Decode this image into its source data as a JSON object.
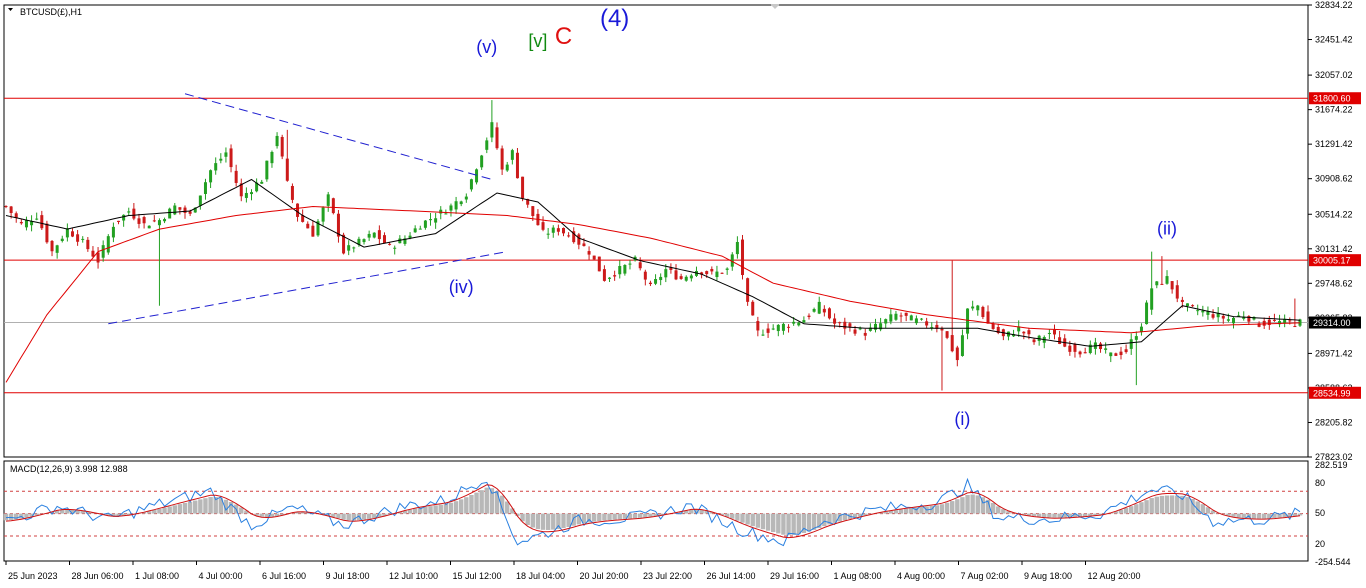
{
  "window": {
    "symbol_label": "BTCUSD(£),H1"
  },
  "colors": {
    "background": "#ffffff",
    "frame": "#000000",
    "up_candle": "#22a022",
    "down_candle": "#cc1a1a",
    "ma_fast": "#000000",
    "ma_slow": "#e00000",
    "trendline": "#2020d0",
    "hline": "#e00000",
    "price_line": "#b0b0b0",
    "wave_blue": "#1a1ad8",
    "wave_green": "#108a10",
    "wave_red": "#e01010",
    "macd_hist": "#b8b8b8",
    "macd_line": "#2a80e0",
    "signal_line": "#d01010"
  },
  "chart_data": [
    {
      "type": "candlestick",
      "title": "BTCUSD(£),H1",
      "ylim": [
        27823.02,
        32834.22
      ],
      "y_ticks": [
        "32834.22",
        "32451.42",
        "32057.02",
        "31674.22",
        "31291.42",
        "30908.62",
        "30514.22",
        "30131.42",
        "29748.62",
        "29365.82",
        "28971.42",
        "28588.62",
        "28205.82",
        "27823.02"
      ],
      "x_ticks": [
        "25 Jun 2023",
        "28 Jun 06:00",
        "1 Jul 08:00",
        "4 Jul 00:00",
        "6 Jul 16:00",
        "9 Jul 18:00",
        "12 Jul 10:00",
        "15 Jul 12:00",
        "18 Jul 04:00",
        "20 Jul 20:00",
        "23 Jul 22:00",
        "26 Jul 14:00",
        "29 Jul 16:00",
        "1 Aug 08:00",
        "4 Aug 00:00",
        "7 Aug 02:00",
        "9 Aug 18:00",
        "12 Aug 20:00"
      ],
      "horizontal_lines": [
        {
          "value": 31800.6,
          "label": "31800.60"
        },
        {
          "value": 30005.17,
          "label": "30005.17"
        },
        {
          "value": 28534.99,
          "label": "28534.99"
        }
      ],
      "current_price": {
        "value": 29314.0,
        "label": "29314.00"
      },
      "price_path": [
        [
          0,
          30600
        ],
        [
          3,
          30400
        ],
        [
          6,
          30500
        ],
        [
          9,
          30100
        ],
        [
          12,
          30350
        ],
        [
          15,
          30200
        ],
        [
          18,
          30000
        ],
        [
          21,
          30400
        ],
        [
          24,
          30550
        ],
        [
          27,
          30400
        ],
        [
          30,
          30450
        ],
        [
          33,
          30600
        ],
        [
          36,
          30500
        ],
        [
          40,
          31000
        ],
        [
          43,
          31200
        ],
        [
          46,
          30700
        ],
        [
          50,
          30900
        ],
        [
          53,
          31400
        ],
        [
          55,
          30850
        ],
        [
          57,
          30500
        ],
        [
          60,
          30300
        ],
        [
          63,
          30700
        ],
        [
          66,
          30100
        ],
        [
          69,
          30200
        ],
        [
          72,
          30300
        ],
        [
          75,
          30150
        ],
        [
          78,
          30250
        ],
        [
          81,
          30400
        ],
        [
          84,
          30500
        ],
        [
          87,
          30600
        ],
        [
          90,
          30750
        ],
        [
          93,
          31200
        ],
        [
          95,
          31500
        ],
        [
          97,
          31000
        ],
        [
          99,
          31200
        ],
        [
          101,
          30700
        ],
        [
          103,
          30500
        ],
        [
          105,
          30300
        ],
        [
          108,
          30350
        ],
        [
          111,
          30250
        ],
        [
          114,
          30100
        ],
        [
          117,
          29800
        ],
        [
          120,
          29900
        ],
        [
          123,
          30000
        ],
        [
          126,
          29700
        ],
        [
          129,
          29900
        ],
        [
          132,
          29800
        ],
        [
          135,
          29900
        ],
        [
          138,
          29850
        ],
        [
          141,
          29900
        ],
        [
          143,
          30200
        ],
        [
          145,
          29500
        ],
        [
          147,
          29200
        ],
        [
          150,
          29250
        ],
        [
          153,
          29300
        ],
        [
          156,
          29350
        ],
        [
          159,
          29500
        ],
        [
          162,
          29300
        ],
        [
          165,
          29250
        ],
        [
          168,
          29200
        ],
        [
          171,
          29300
        ],
        [
          174,
          29400
        ],
        [
          177,
          29350
        ],
        [
          180,
          29300
        ],
        [
          183,
          29250
        ],
        [
          186,
          28900
        ],
        [
          188,
          29450
        ],
        [
          190,
          29500
        ],
        [
          192,
          29300
        ],
        [
          195,
          29150
        ],
        [
          198,
          29250
        ],
        [
          201,
          29100
        ],
        [
          204,
          29200
        ],
        [
          207,
          29050
        ],
        [
          210,
          29000
        ],
        [
          213,
          29050
        ],
        [
          216,
          28950
        ],
        [
          219,
          29000
        ],
        [
          222,
          29300
        ],
        [
          224,
          29700
        ],
        [
          227,
          29800
        ],
        [
          230,
          29500
        ],
        [
          233,
          29450
        ],
        [
          236,
          29400
        ],
        [
          239,
          29350
        ],
        [
          242,
          29400
        ],
        [
          245,
          29300
        ],
        [
          248,
          29320
        ],
        [
          251,
          29310
        ],
        [
          253,
          29314
        ]
      ],
      "spikes": [
        {
          "at": 30,
          "wick_low": 29500
        },
        {
          "at": 55,
          "wick_high": 31450
        },
        {
          "at": 95,
          "wick_high": 31780
        },
        {
          "at": 183,
          "wick_low": 28560
        },
        {
          "at": 185,
          "wick_high": 30000
        },
        {
          "at": 221,
          "wick_low": 28620
        },
        {
          "at": 224,
          "wick_high": 30100
        },
        {
          "at": 226,
          "wick_high": 30050
        },
        {
          "at": 252,
          "wick_high": 29580
        }
      ],
      "ma_fast_points": [
        [
          0,
          30500
        ],
        [
          12,
          30350
        ],
        [
          24,
          30500
        ],
        [
          36,
          30550
        ],
        [
          48,
          30900
        ],
        [
          58,
          30500
        ],
        [
          70,
          30150
        ],
        [
          84,
          30300
        ],
        [
          96,
          30750
        ],
        [
          104,
          30650
        ],
        [
          112,
          30250
        ],
        [
          124,
          30000
        ],
        [
          136,
          29850
        ],
        [
          146,
          29600
        ],
        [
          156,
          29300
        ],
        [
          168,
          29250
        ],
        [
          180,
          29250
        ],
        [
          190,
          29250
        ],
        [
          200,
          29150
        ],
        [
          212,
          29050
        ],
        [
          222,
          29100
        ],
        [
          230,
          29500
        ],
        [
          240,
          29380
        ],
        [
          253,
          29340
        ]
      ],
      "ma_slow_points": [
        [
          0,
          28650
        ],
        [
          8,
          29400
        ],
        [
          18,
          30100
        ],
        [
          30,
          30350
        ],
        [
          45,
          30500
        ],
        [
          60,
          30600
        ],
        [
          80,
          30550
        ],
        [
          98,
          30500
        ],
        [
          112,
          30400
        ],
        [
          126,
          30250
        ],
        [
          140,
          30050
        ],
        [
          150,
          29750
        ],
        [
          165,
          29550
        ],
        [
          180,
          29400
        ],
        [
          200,
          29250
        ],
        [
          220,
          29200
        ],
        [
          235,
          29280
        ],
        [
          253,
          29310
        ]
      ],
      "trendlines": [
        {
          "from": [
            35,
            31850
          ],
          "to": [
            95,
            30900
          ]
        },
        {
          "from": [
            20,
            29300
          ],
          "to": [
            98,
            30100
          ]
        }
      ],
      "wave_labels": [
        {
          "text": "(v)",
          "at": [
            94,
            32300
          ],
          "color": "wave_blue"
        },
        {
          "text": "[v]",
          "at": [
            104,
            32370
          ],
          "color": "wave_green"
        },
        {
          "text": "C",
          "at": [
            109,
            32400
          ],
          "color": "wave_red"
        },
        {
          "text": "(4)",
          "at": [
            119,
            32600
          ],
          "color": "wave_blue"
        },
        {
          "text": "(iv)",
          "at": [
            89,
            29640
          ],
          "color": "wave_blue"
        },
        {
          "text": "(i)",
          "at": [
            187,
            28180
          ],
          "color": "wave_blue"
        },
        {
          "text": "(ii)",
          "at": [
            227,
            30290
          ],
          "color": "wave_blue"
        }
      ]
    },
    {
      "type": "macd",
      "title": "MACD(12,26,9) 3.998 12.988",
      "ylim": [
        -254.544,
        282.519
      ],
      "y_ticks": [
        "282.519",
        "80",
        "50",
        "20",
        "-254.544"
      ],
      "levels": [
        120,
        0,
        -120
      ],
      "macd_path": [
        [
          0,
          -40
        ],
        [
          10,
          40
        ],
        [
          20,
          -30
        ],
        [
          30,
          50
        ],
        [
          40,
          120
        ],
        [
          48,
          -60
        ],
        [
          56,
          30
        ],
        [
          66,
          -60
        ],
        [
          78,
          40
        ],
        [
          86,
          70
        ],
        [
          94,
          200
        ],
        [
          100,
          -150
        ],
        [
          104,
          -120
        ],
        [
          112,
          -40
        ],
        [
          124,
          -20
        ],
        [
          134,
          40
        ],
        [
          144,
          -90
        ],
        [
          152,
          -150
        ],
        [
          160,
          -40
        ],
        [
          170,
          20
        ],
        [
          182,
          60
        ],
        [
          188,
          150
        ],
        [
          194,
          -20
        ],
        [
          204,
          -30
        ],
        [
          214,
          0
        ],
        [
          224,
          130
        ],
        [
          230,
          100
        ],
        [
          236,
          -40
        ],
        [
          246,
          -30
        ],
        [
          253,
          0
        ]
      ]
    }
  ]
}
